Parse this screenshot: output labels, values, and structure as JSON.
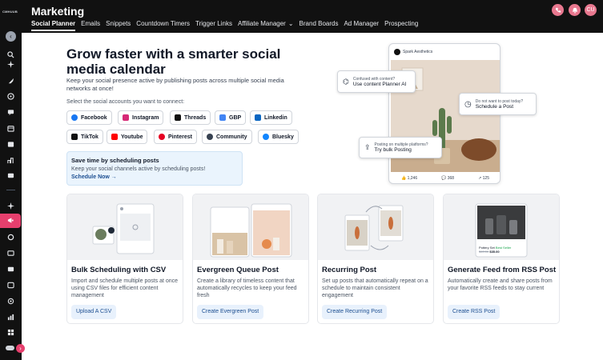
{
  "brand": {
    "logo_text": "CMHUUB",
    "accent": "#e63f6d"
  },
  "header": {
    "title": "Marketing",
    "tabs": [
      {
        "label": "Social Planner"
      },
      {
        "label": "Emails"
      },
      {
        "label": "Snippets"
      },
      {
        "label": "Countdown Timers"
      },
      {
        "label": "Trigger Links"
      },
      {
        "label": "Affiliate Manager"
      },
      {
        "label": "Brand Boards"
      },
      {
        "label": "Ad Manager"
      },
      {
        "label": "Prospecting"
      }
    ],
    "user_initials": "CU"
  },
  "hero": {
    "title": "Grow faster with a smarter social media calendar",
    "subtitle": "Keep your social presence active by publishing posts across multiple social media networks at once!",
    "select_label": "Select the social accounts you want to connect:"
  },
  "accounts": [
    {
      "label": "Facebook",
      "color": "#1877f2"
    },
    {
      "label": "Instagram",
      "color": "#d62976"
    },
    {
      "label": "Threads",
      "color": "#111111"
    },
    {
      "label": "GBP",
      "color": "#4285f4"
    },
    {
      "label": "Linkedin",
      "color": "#0a66c2"
    },
    {
      "label": "TikTok",
      "color": "#111111"
    },
    {
      "label": "Youtube",
      "color": "#ff0000"
    },
    {
      "label": "Pinterest",
      "color": "#e60023"
    },
    {
      "label": "Community",
      "color": "#374151"
    },
    {
      "label": "Bluesky",
      "color": "#1185fe"
    }
  ],
  "promo": {
    "title": "Save time by scheduling posts",
    "subtitle": "Keep your social channels active by scheduling posts!",
    "link": "Schedule Now"
  },
  "mockup": {
    "account_name": "Spark Aesthetics",
    "likes": "1,246",
    "comments": "368",
    "shares": "125",
    "ai_tip": {
      "small": "Confused with content?",
      "main": "Use content Planner AI"
    },
    "schedule_tip": {
      "small": "Do not want to post today?",
      "main": "Schedule a Post"
    },
    "bulk_tip": {
      "small": "Posting on multiple platforms?",
      "main": "Try bulk Posting"
    }
  },
  "cards": [
    {
      "title": "Bulk Scheduling with CSV",
      "description": "Import and schedule multiple posts at once using CSV files for efficient content management",
      "button": "Upload A CSV"
    },
    {
      "title": "Evergreen Queue Post",
      "description": "Create a library of timeless content that automatically recycles to keep your feed fresh",
      "button": "Create Evergreen Post"
    },
    {
      "title": "Recurring Post",
      "description": "Set up posts that automatically repeat on a schedule to maintain consistent engagement",
      "button": "Create Recurring Post"
    },
    {
      "title": "Generate Feed from RSS Post",
      "description": "Automatically create and share posts from your favorite RSS feeds to stay current",
      "button": "Create RSS Post"
    }
  ],
  "rss_product": {
    "name": "Pottery Set",
    "badge": "Best Seller",
    "old_price": "$40.00",
    "price": "$35.00"
  }
}
